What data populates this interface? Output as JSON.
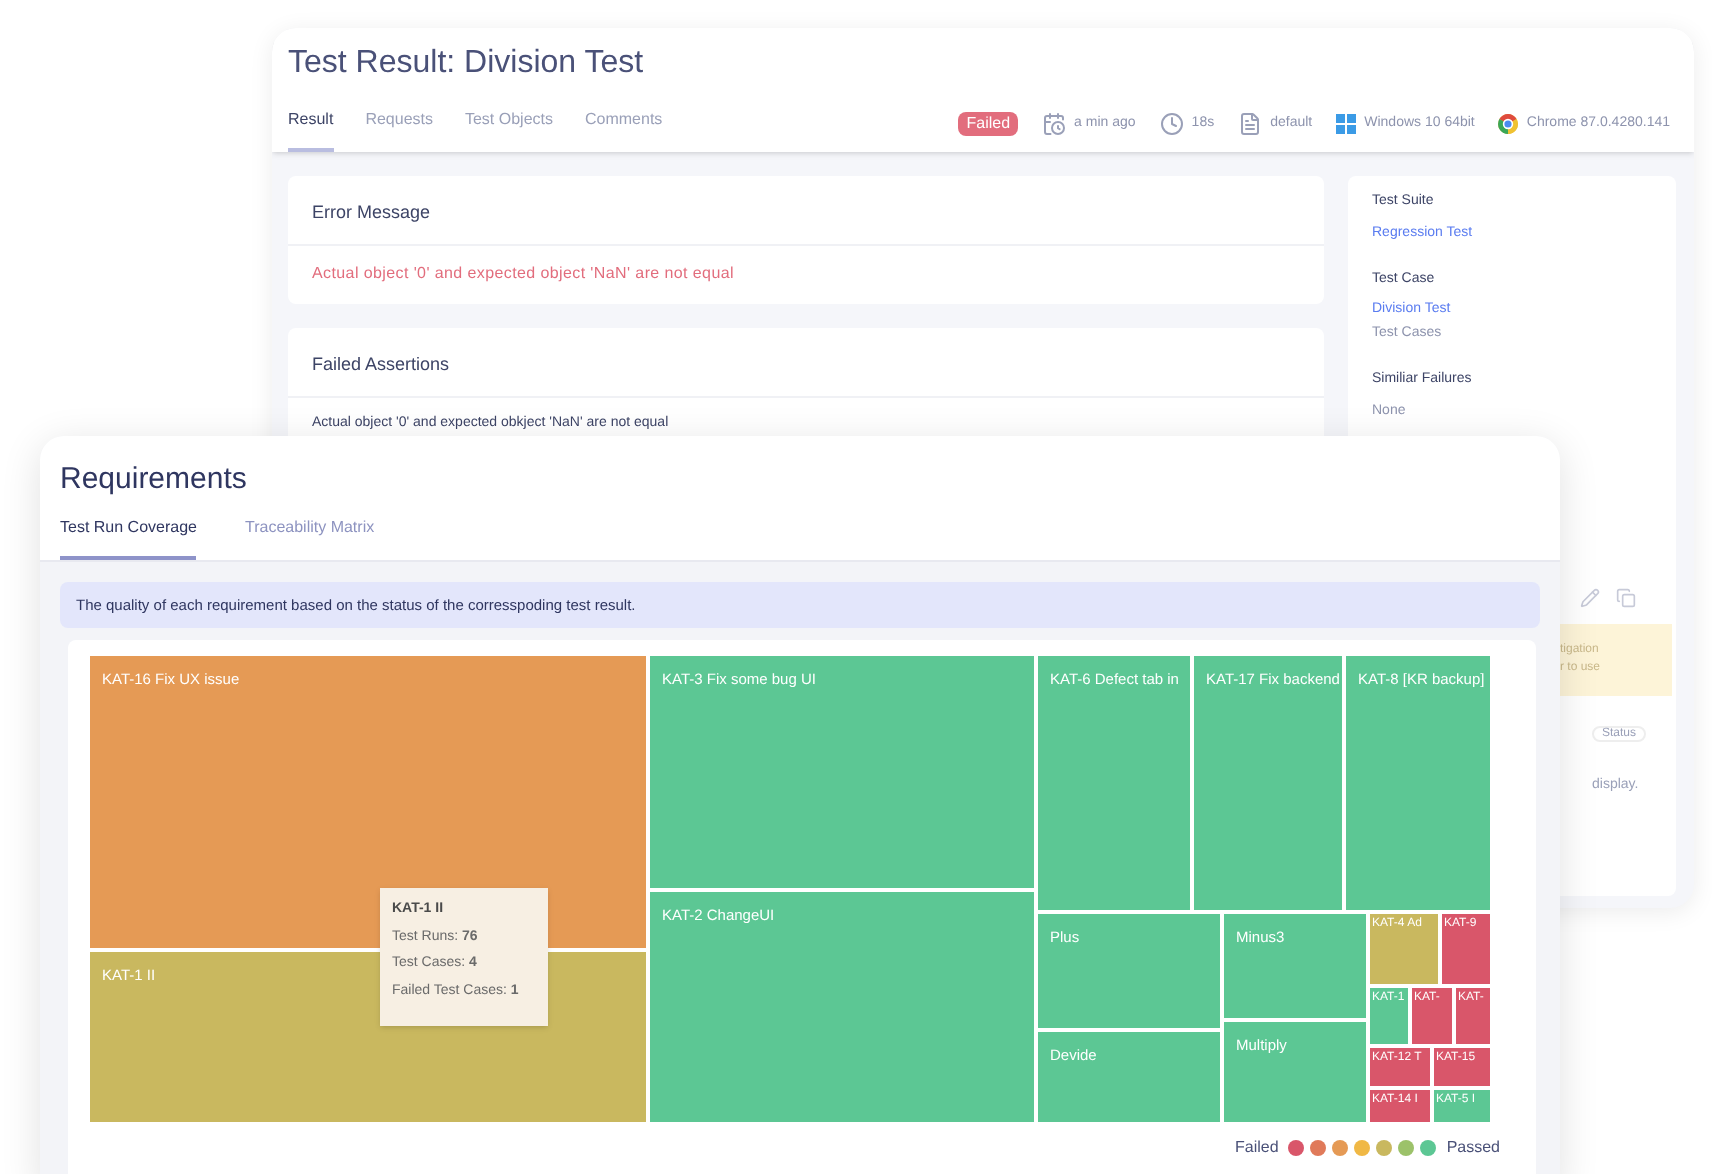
{
  "back_window": {
    "title": "Test Result: Division Test",
    "tabs": [
      {
        "label": "Result",
        "selected": true
      },
      {
        "label": "Requests",
        "selected": false
      },
      {
        "label": "Test Objects",
        "selected": false
      },
      {
        "label": "Comments",
        "selected": false
      }
    ],
    "status_badge": "Failed",
    "meta": [
      {
        "kind": "time",
        "text": "a min ago"
      },
      {
        "kind": "duration",
        "text": "18s"
      },
      {
        "kind": "profile",
        "text": "default"
      },
      {
        "kind": "os",
        "text": "Windows 10 64bit"
      },
      {
        "kind": "browser",
        "text": "Chrome 87.0.4280.141"
      }
    ],
    "error_message": {
      "title": "Error Message",
      "text": "Actual object '0' and expected object 'NaN' are not equal"
    },
    "failed_assertions": {
      "title": "Failed Assertions",
      "text": "Actual object '0' and expected obkject 'NaN' are not equal"
    },
    "sidebar": [
      {
        "label": "Test Suite",
        "items": [
          {
            "kind": "link",
            "text": "Regression Test"
          }
        ]
      },
      {
        "label": "Test Case",
        "items": [
          {
            "kind": "link",
            "text": "Division Test"
          },
          {
            "kind": "plain",
            "text": "Test Cases"
          }
        ]
      },
      {
        "label": "Similiar Failures",
        "items": [
          {
            "kind": "plain",
            "text": "None"
          }
        ]
      }
    ],
    "notice_lines": [
      "tigation",
      "r to use"
    ],
    "status_button": "Status",
    "footer_text": "display."
  },
  "front_window": {
    "title": "Requirements",
    "tabs": [
      {
        "label": "Test Run Coverage",
        "selected": true
      },
      {
        "label": "Traceability Matrix",
        "selected": false
      }
    ],
    "info_text": "The quality of each requirement based on the status of the corresspoding test result.",
    "treemap": {
      "cells": [
        {
          "label": "KAT-16 Fix UX issue",
          "color": "#e59a55"
        },
        {
          "label": "KAT-1 II",
          "color": "#c9b85f"
        },
        {
          "label": "KAT-3 Fix some bug UI",
          "color": "#5cc794"
        },
        {
          "label": "KAT-2 ChangeUI",
          "color": "#5cc794"
        },
        {
          "label": "KAT-6 Defect tab in",
          "color": "#5cc794"
        },
        {
          "label": "KAT-17 Fix backend",
          "color": "#5cc794"
        },
        {
          "label": "KAT-8 [KR backup]",
          "color": "#5cc794"
        },
        {
          "label": "Plus",
          "color": "#5cc794"
        },
        {
          "label": "Devide",
          "color": "#5cc794"
        },
        {
          "label": "Minus3",
          "color": "#5cc794"
        },
        {
          "label": "Multiply",
          "color": "#5cc794"
        },
        {
          "label": "KAT-4 Ad",
          "color": "#c9b85f"
        },
        {
          "label": "KAT-9",
          "color": "#d9566a"
        },
        {
          "label": "KAT-1",
          "color": "#5cc794"
        },
        {
          "label": "KAT-",
          "color": "#d9566a"
        },
        {
          "label": "KAT-",
          "color": "#d9566a"
        },
        {
          "label": "KAT-12 T",
          "color": "#d9566a"
        },
        {
          "label": "KAT-15",
          "color": "#d9566a"
        },
        {
          "label": "KAT-14 I",
          "color": "#d9566a"
        },
        {
          "label": "KAT-5 I",
          "color": "#5cc794"
        }
      ],
      "tooltip": {
        "title": "KAT-1 II",
        "lines": [
          "Test Runs: **76**",
          "Test Cases: **4**",
          "Failed Test Cases: **1**"
        ]
      }
    },
    "legend": {
      "low": "Failed",
      "high": "Passed",
      "steps": [
        {
          "color": "#d9566a"
        },
        {
          "color": "#e07a5a"
        },
        {
          "color": "#e59a55"
        },
        {
          "color": "#f0b845"
        },
        {
          "color": "#c9b85f"
        },
        {
          "color": "#9cc26a"
        },
        {
          "color": "#5cc794"
        }
      ]
    }
  }
}
